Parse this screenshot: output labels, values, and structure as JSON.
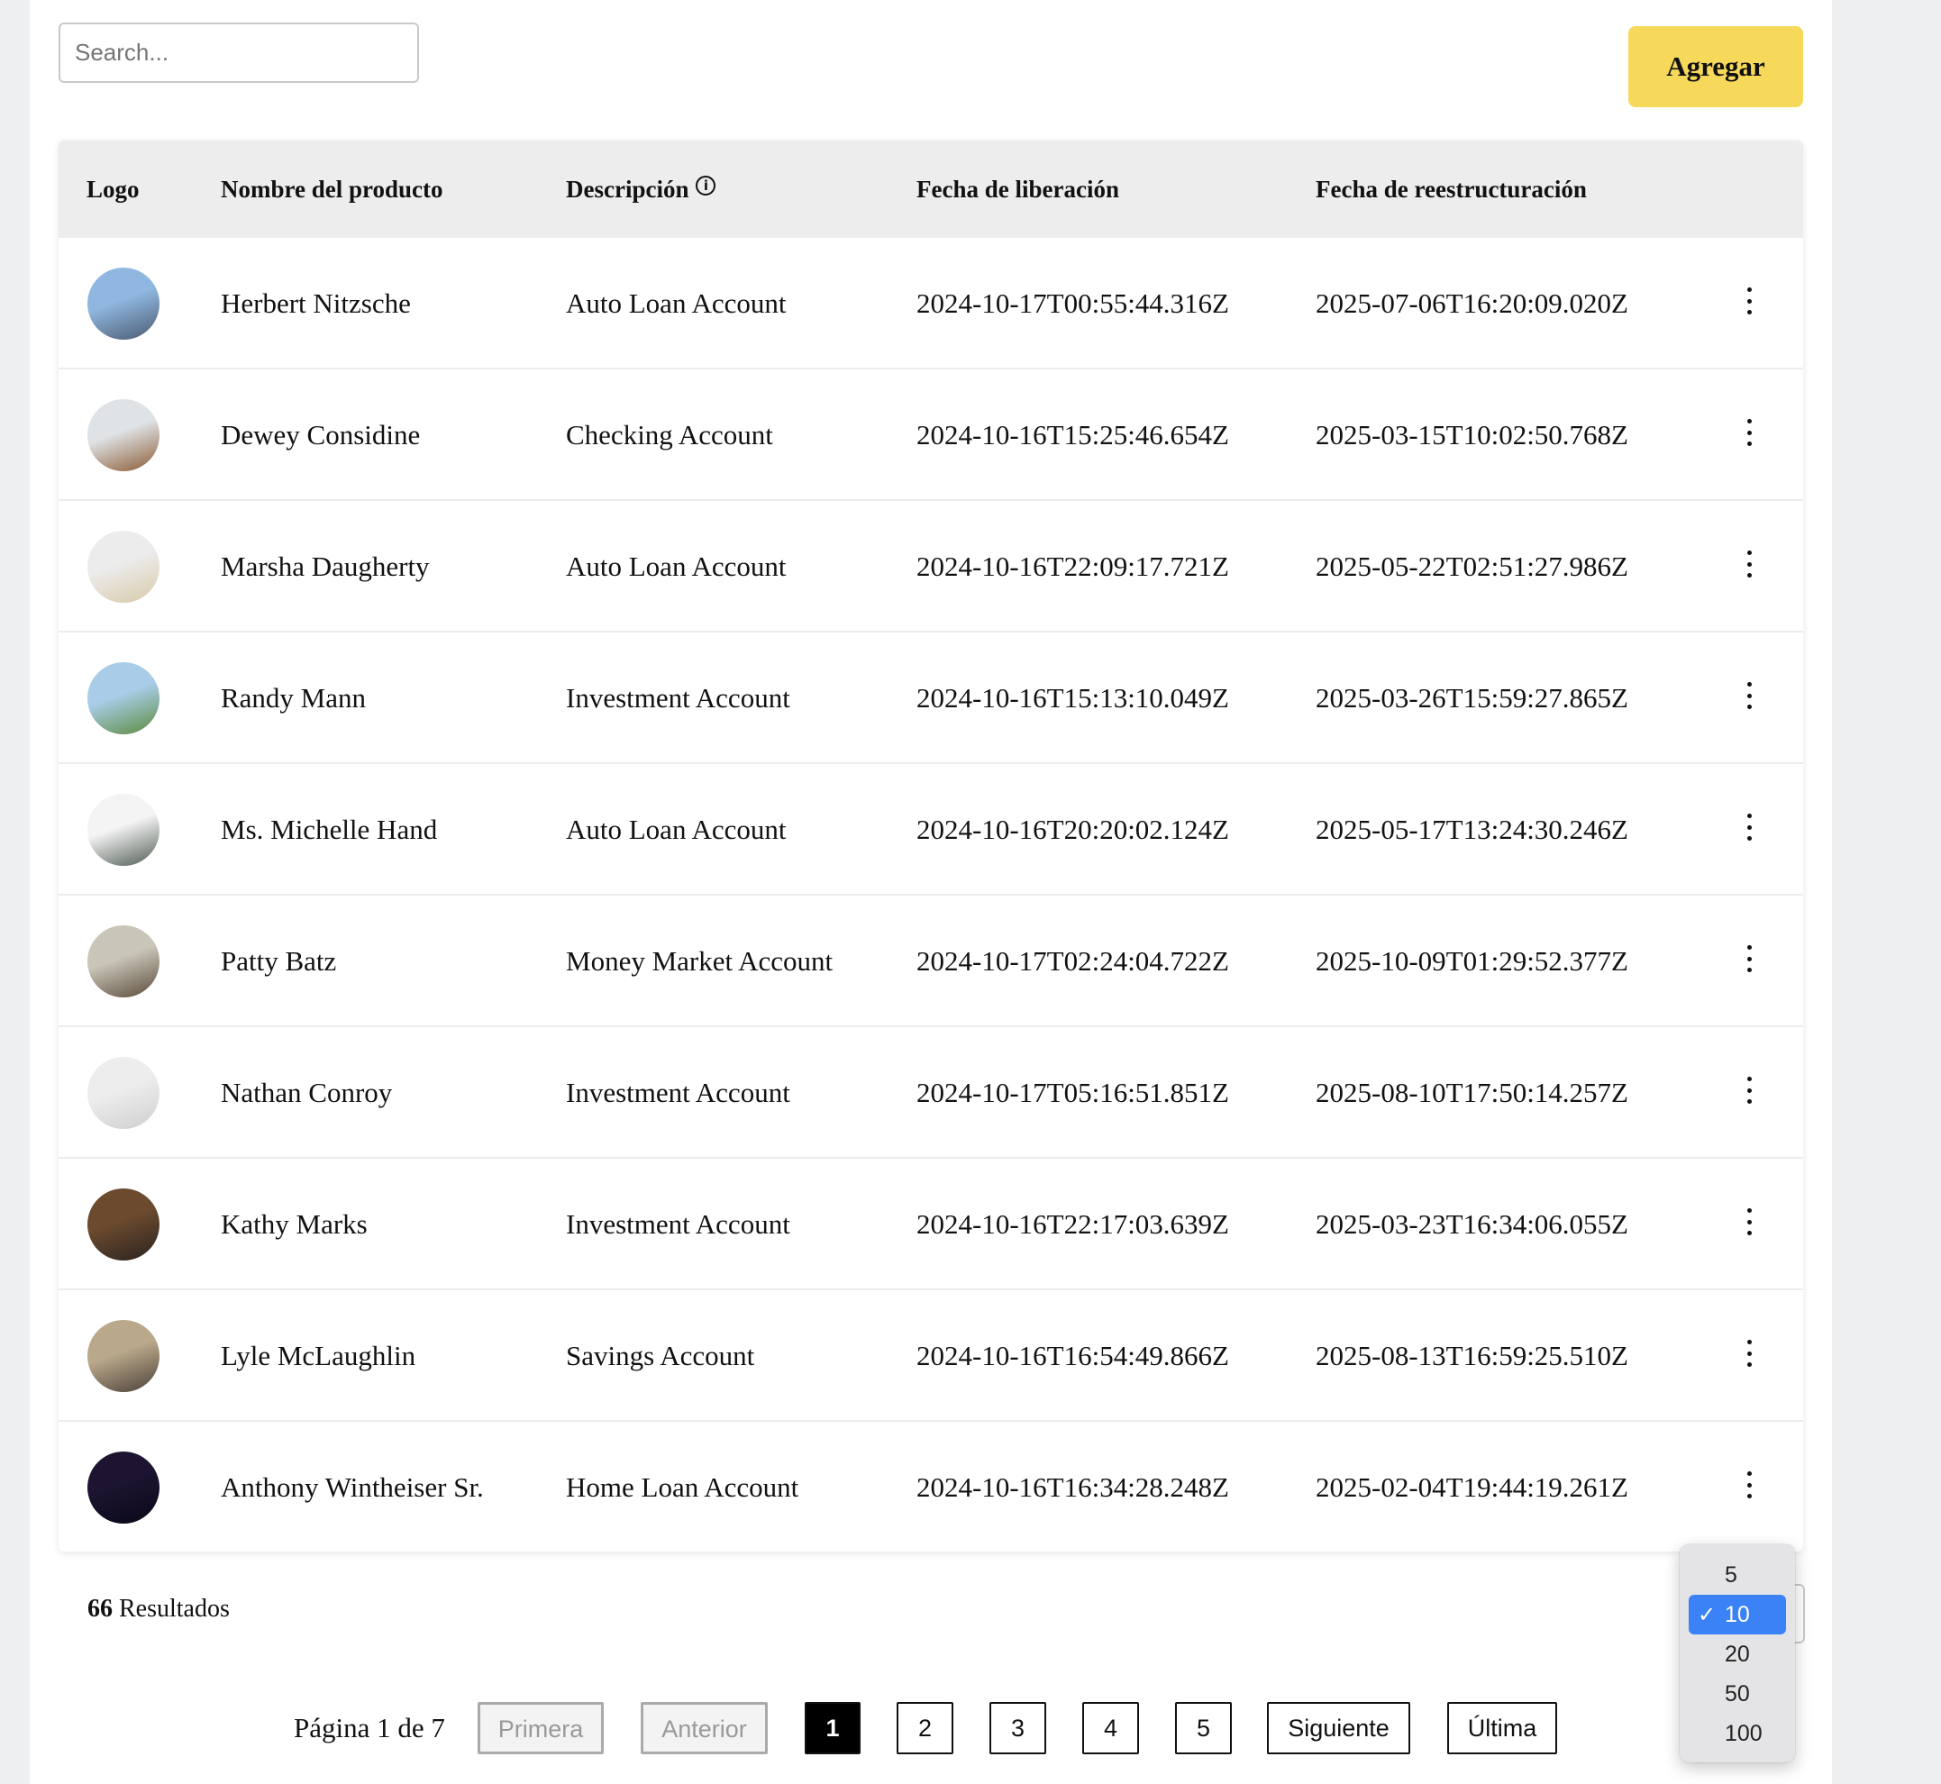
{
  "search": {
    "placeholder": "Search..."
  },
  "toolbar": {
    "add_label": "Agregar"
  },
  "table": {
    "headers": {
      "logo": "Logo",
      "name": "Nombre del producto",
      "description": "Descripción",
      "release": "Fecha de liberación",
      "restructure": "Fecha de reestructuración"
    },
    "rows": [
      {
        "name": "Herbert Nitzsche",
        "description": "Auto Loan Account",
        "release": "2024-10-17T00:55:44.316Z",
        "restructure": "2025-07-06T16:20:09.020Z",
        "avatar_colors": [
          "#8fb7e0",
          "#4a5a70"
        ]
      },
      {
        "name": "Dewey Considine",
        "description": "Checking Account",
        "release": "2024-10-16T15:25:46.654Z",
        "restructure": "2025-03-15T10:02:50.768Z",
        "avatar_colors": [
          "#dfe3e6",
          "#8a5a34"
        ]
      },
      {
        "name": "Marsha Daugherty",
        "description": "Auto Loan Account",
        "release": "2024-10-16T22:09:17.721Z",
        "restructure": "2025-05-22T02:51:27.986Z",
        "avatar_colors": [
          "#ececec",
          "#d8c9a8"
        ]
      },
      {
        "name": "Randy Mann",
        "description": "Investment Account",
        "release": "2024-10-16T15:13:10.049Z",
        "restructure": "2025-03-26T15:59:27.865Z",
        "avatar_colors": [
          "#a9cde8",
          "#5b8a3c"
        ]
      },
      {
        "name": "Ms. Michelle Hand",
        "description": "Auto Loan Account",
        "release": "2024-10-16T20:20:02.124Z",
        "restructure": "2025-05-17T13:24:30.246Z",
        "avatar_colors": [
          "#f4f4f4",
          "#4f5a52"
        ]
      },
      {
        "name": "Patty Batz",
        "description": "Money Market Account",
        "release": "2024-10-17T02:24:04.722Z",
        "restructure": "2025-10-09T01:29:52.377Z",
        "avatar_colors": [
          "#c9c5b8",
          "#5a4a3a"
        ]
      },
      {
        "name": "Nathan Conroy",
        "description": "Investment Account",
        "release": "2024-10-17T05:16:51.851Z",
        "restructure": "2025-08-10T17:50:14.257Z",
        "avatar_colors": [
          "#ededed",
          "#cfcfcf"
        ]
      },
      {
        "name": "Kathy Marks",
        "description": "Investment Account",
        "release": "2024-10-16T22:17:03.639Z",
        "restructure": "2025-03-23T16:34:06.055Z",
        "avatar_colors": [
          "#6b4a2e",
          "#2a2320"
        ]
      },
      {
        "name": "Lyle McLaughlin",
        "description": "Savings Account",
        "release": "2024-10-16T16:54:49.866Z",
        "restructure": "2025-08-13T16:59:25.510Z",
        "avatar_colors": [
          "#b9a88a",
          "#4a4038"
        ]
      },
      {
        "name": "Anthony Wintheiser Sr.",
        "description": "Home Loan Account",
        "release": "2024-10-16T16:34:28.248Z",
        "restructure": "2025-02-04T19:44:19.261Z",
        "avatar_colors": [
          "#1c1430",
          "#0a0818"
        ]
      }
    ]
  },
  "results": {
    "count": "66",
    "label": "Resultados"
  },
  "pagination": {
    "page_text": "Página 1 de 7",
    "first": "Primera",
    "prev": "Anterior",
    "pages": [
      "1",
      "2",
      "3",
      "4",
      "5"
    ],
    "current": "1",
    "next": "Siguiente",
    "last": "Última"
  },
  "page_size": {
    "options": [
      "5",
      "10",
      "20",
      "50",
      "100"
    ],
    "selected": "10",
    "check": "✓"
  },
  "colors": {
    "accent": "#f6d95a",
    "selected": "#3b82f6",
    "header_bg": "#ededee"
  },
  "icons": {
    "info": "info-icon",
    "row_menu": "kebab-menu-icon",
    "check": "checkmark-icon"
  }
}
